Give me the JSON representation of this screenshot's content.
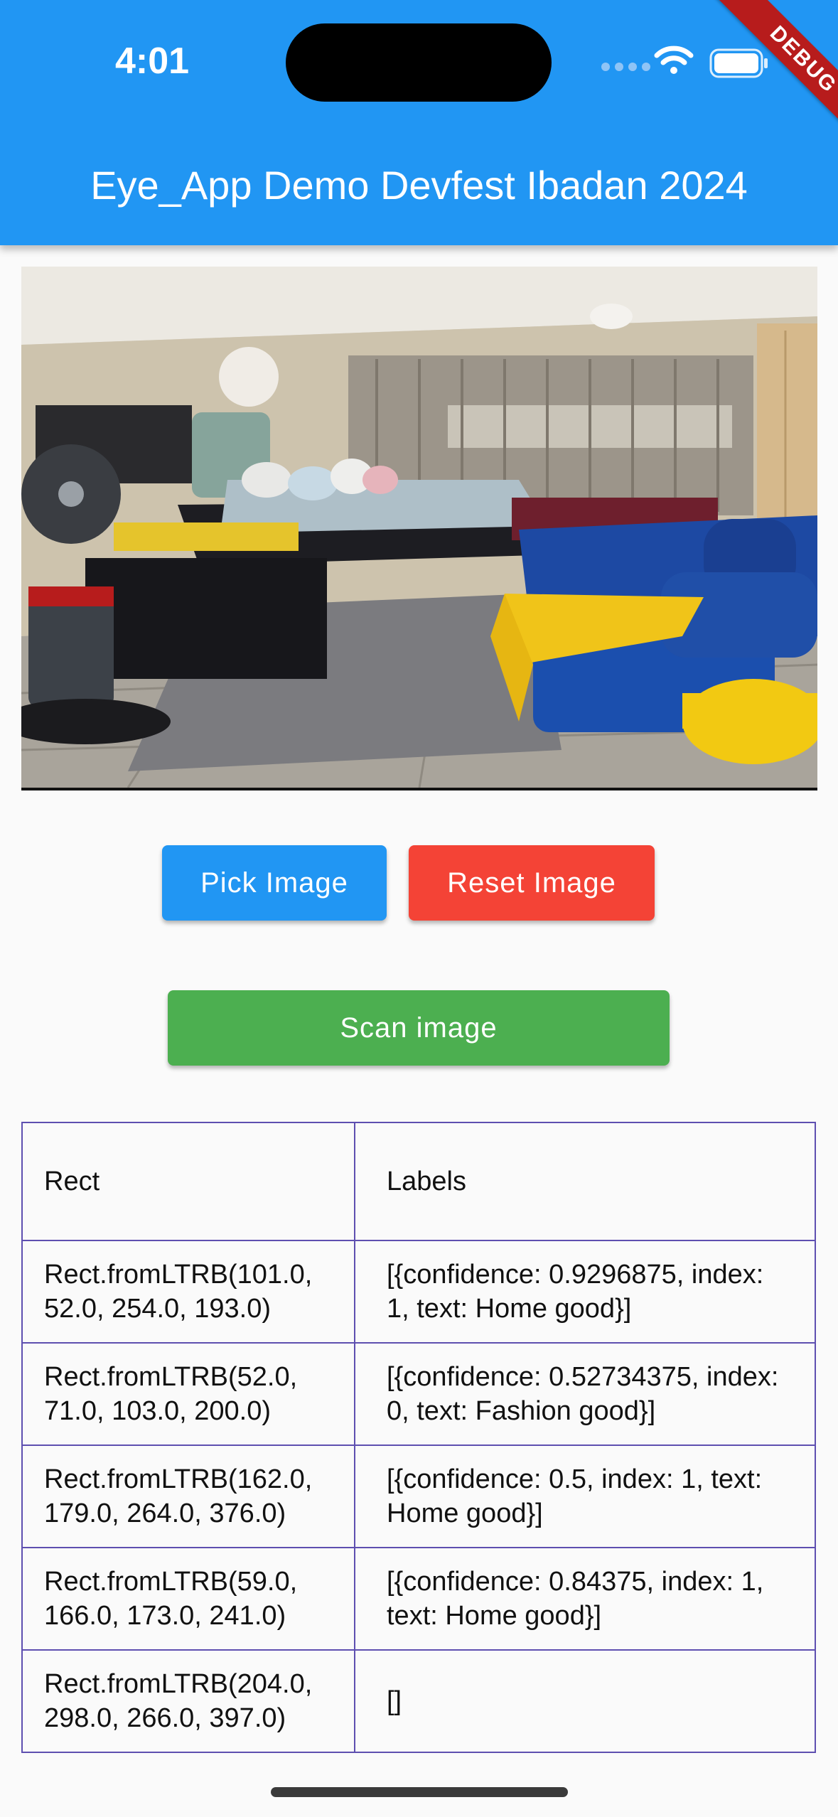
{
  "status_bar": {
    "time": "4:01"
  },
  "debug_banner": "DEBUG",
  "app_bar": {
    "title": "Eye_App Demo Devfest Ibadan 2024"
  },
  "buttons": {
    "pick": "Pick Image",
    "reset": "Reset Image",
    "scan": "Scan image"
  },
  "colors": {
    "app_bar": "#2196f3",
    "pick": "#2196f3",
    "reset": "#f44336",
    "scan": "#4caf50",
    "table_border": "#5e4fb0"
  },
  "table": {
    "headers": [
      "Rect",
      "Labels"
    ],
    "rows": [
      [
        "Rect.fromLTRB(101.0, 52.0, 254.0, 193.0)",
        "[{confidence: 0.9296875, index: 1, text: Home good}]"
      ],
      [
        "Rect.fromLTRB(52.0, 71.0, 103.0, 200.0)",
        "[{confidence: 0.52734375, index: 0, text: Fashion good}]"
      ],
      [
        "Rect.fromLTRB(162.0, 179.0, 264.0, 376.0)",
        "[{confidence: 0.5, index: 1, text: Home good}]"
      ],
      [
        "Rect.fromLTRB(59.0, 166.0, 173.0, 241.0)",
        "[{confidence: 0.84375, index: 1, text: Home good}]"
      ],
      [
        "Rect.fromLTRB(204.0, 298.0, 266.0, 397.0)",
        "[]"
      ]
    ]
  }
}
